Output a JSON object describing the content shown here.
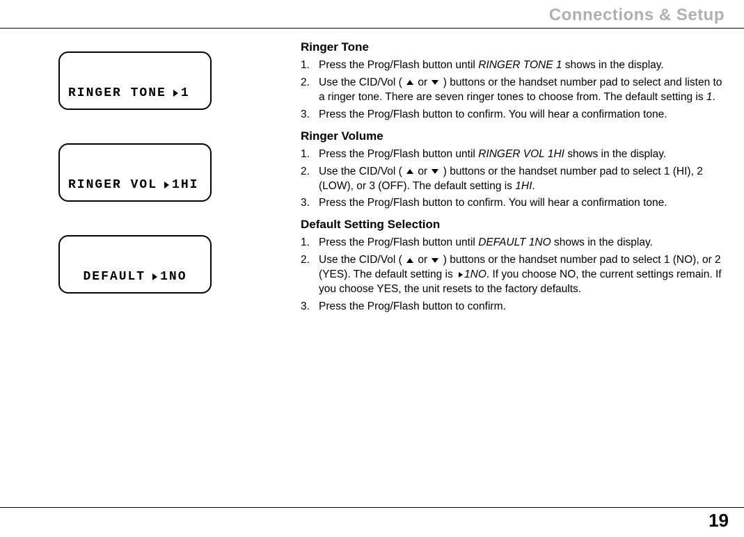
{
  "header": {
    "title": "Connections & Setup"
  },
  "lcd": {
    "screen1_label": "RINGER TONE",
    "screen1_value": "1",
    "screen2_label": "RINGER VOL",
    "screen2_value": "1HI",
    "screen3_label": "DEFAULT",
    "screen3_value": "1NO"
  },
  "sections": {
    "ringer_tone": {
      "heading": "Ringer Tone",
      "step1_a": "Press the Prog/Flash button until ",
      "step1_b": "RINGER TONE 1",
      "step1_c": " shows in the display.",
      "step2_a": "Use the CID/Vol ( ",
      "step2_or": " or ",
      "step2_b": " ) buttons or the handset number pad to select and listen to a ringer tone. There are seven ringer tones to choose from. The default setting is ",
      "step2_c": "1",
      "step2_d": ".",
      "step3": "Press the Prog/Flash button to confirm. You will hear a confirmation tone."
    },
    "ringer_volume": {
      "heading": "Ringer Volume",
      "step1_a": "Press the Prog/Flash button until ",
      "step1_b": "RINGER VOL 1HI",
      "step1_c": " shows in the display.",
      "step2_a": "Use the CID/Vol ( ",
      "step2_or": " or ",
      "step2_b": " ) buttons or the handset number pad to select 1 (HI), 2 (LOW), or 3 (OFF). The default setting is ",
      "step2_c": "1HI",
      "step2_d": ".",
      "step3": "Press the Prog/Flash button to confirm. You will hear a confirmation tone."
    },
    "default_setting": {
      "heading": "Default Setting Selection",
      "step1_a": "Press the Prog/Flash button until ",
      "step1_b": "DEFAULT 1NO",
      "step1_c": " shows in the display.",
      "step2_a": "Use the CID/Vol ( ",
      "step2_or": " or ",
      "step2_b": " ) buttons or the handset number pad to select 1 (NO), or 2 (YES). The default setting is ",
      "step2_c": "1NO",
      "step2_d": ". If you choose NO, the current settings remain. If you choose YES, the unit resets to the factory defaults.",
      "step3": "Press the Prog/Flash button to confirm."
    }
  },
  "footer": {
    "page_number": "19"
  }
}
